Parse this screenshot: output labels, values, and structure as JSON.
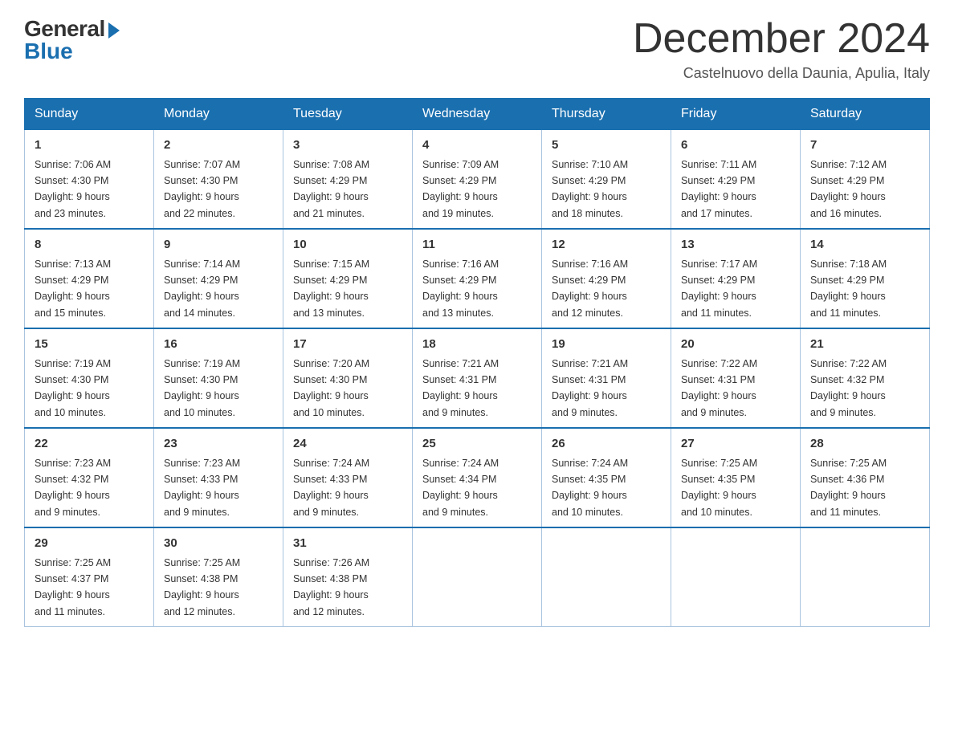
{
  "logo": {
    "general": "General",
    "blue": "Blue"
  },
  "header": {
    "month_year": "December 2024",
    "location": "Castelnuovo della Daunia, Apulia, Italy"
  },
  "weekdays": [
    "Sunday",
    "Monday",
    "Tuesday",
    "Wednesday",
    "Thursday",
    "Friday",
    "Saturday"
  ],
  "weeks": [
    [
      {
        "day": "1",
        "sunrise": "7:06 AM",
        "sunset": "4:30 PM",
        "daylight": "9 hours and 23 minutes."
      },
      {
        "day": "2",
        "sunrise": "7:07 AM",
        "sunset": "4:30 PM",
        "daylight": "9 hours and 22 minutes."
      },
      {
        "day": "3",
        "sunrise": "7:08 AM",
        "sunset": "4:29 PM",
        "daylight": "9 hours and 21 minutes."
      },
      {
        "day": "4",
        "sunrise": "7:09 AM",
        "sunset": "4:29 PM",
        "daylight": "9 hours and 19 minutes."
      },
      {
        "day": "5",
        "sunrise": "7:10 AM",
        "sunset": "4:29 PM",
        "daylight": "9 hours and 18 minutes."
      },
      {
        "day": "6",
        "sunrise": "7:11 AM",
        "sunset": "4:29 PM",
        "daylight": "9 hours and 17 minutes."
      },
      {
        "day": "7",
        "sunrise": "7:12 AM",
        "sunset": "4:29 PM",
        "daylight": "9 hours and 16 minutes."
      }
    ],
    [
      {
        "day": "8",
        "sunrise": "7:13 AM",
        "sunset": "4:29 PM",
        "daylight": "9 hours and 15 minutes."
      },
      {
        "day": "9",
        "sunrise": "7:14 AM",
        "sunset": "4:29 PM",
        "daylight": "9 hours and 14 minutes."
      },
      {
        "day": "10",
        "sunrise": "7:15 AM",
        "sunset": "4:29 PM",
        "daylight": "9 hours and 13 minutes."
      },
      {
        "day": "11",
        "sunrise": "7:16 AM",
        "sunset": "4:29 PM",
        "daylight": "9 hours and 13 minutes."
      },
      {
        "day": "12",
        "sunrise": "7:16 AM",
        "sunset": "4:29 PM",
        "daylight": "9 hours and 12 minutes."
      },
      {
        "day": "13",
        "sunrise": "7:17 AM",
        "sunset": "4:29 PM",
        "daylight": "9 hours and 11 minutes."
      },
      {
        "day": "14",
        "sunrise": "7:18 AM",
        "sunset": "4:29 PM",
        "daylight": "9 hours and 11 minutes."
      }
    ],
    [
      {
        "day": "15",
        "sunrise": "7:19 AM",
        "sunset": "4:30 PM",
        "daylight": "9 hours and 10 minutes."
      },
      {
        "day": "16",
        "sunrise": "7:19 AM",
        "sunset": "4:30 PM",
        "daylight": "9 hours and 10 minutes."
      },
      {
        "day": "17",
        "sunrise": "7:20 AM",
        "sunset": "4:30 PM",
        "daylight": "9 hours and 10 minutes."
      },
      {
        "day": "18",
        "sunrise": "7:21 AM",
        "sunset": "4:31 PM",
        "daylight": "9 hours and 9 minutes."
      },
      {
        "day": "19",
        "sunrise": "7:21 AM",
        "sunset": "4:31 PM",
        "daylight": "9 hours and 9 minutes."
      },
      {
        "day": "20",
        "sunrise": "7:22 AM",
        "sunset": "4:31 PM",
        "daylight": "9 hours and 9 minutes."
      },
      {
        "day": "21",
        "sunrise": "7:22 AM",
        "sunset": "4:32 PM",
        "daylight": "9 hours and 9 minutes."
      }
    ],
    [
      {
        "day": "22",
        "sunrise": "7:23 AM",
        "sunset": "4:32 PM",
        "daylight": "9 hours and 9 minutes."
      },
      {
        "day": "23",
        "sunrise": "7:23 AM",
        "sunset": "4:33 PM",
        "daylight": "9 hours and 9 minutes."
      },
      {
        "day": "24",
        "sunrise": "7:24 AM",
        "sunset": "4:33 PM",
        "daylight": "9 hours and 9 minutes."
      },
      {
        "day": "25",
        "sunrise": "7:24 AM",
        "sunset": "4:34 PM",
        "daylight": "9 hours and 9 minutes."
      },
      {
        "day": "26",
        "sunrise": "7:24 AM",
        "sunset": "4:35 PM",
        "daylight": "9 hours and 10 minutes."
      },
      {
        "day": "27",
        "sunrise": "7:25 AM",
        "sunset": "4:35 PM",
        "daylight": "9 hours and 10 minutes."
      },
      {
        "day": "28",
        "sunrise": "7:25 AM",
        "sunset": "4:36 PM",
        "daylight": "9 hours and 11 minutes."
      }
    ],
    [
      {
        "day": "29",
        "sunrise": "7:25 AM",
        "sunset": "4:37 PM",
        "daylight": "9 hours and 11 minutes."
      },
      {
        "day": "30",
        "sunrise": "7:25 AM",
        "sunset": "4:38 PM",
        "daylight": "9 hours and 12 minutes."
      },
      {
        "day": "31",
        "sunrise": "7:26 AM",
        "sunset": "4:38 PM",
        "daylight": "9 hours and 12 minutes."
      },
      null,
      null,
      null,
      null
    ]
  ],
  "labels": {
    "sunrise": "Sunrise:",
    "sunset": "Sunset:",
    "daylight": "Daylight:"
  }
}
